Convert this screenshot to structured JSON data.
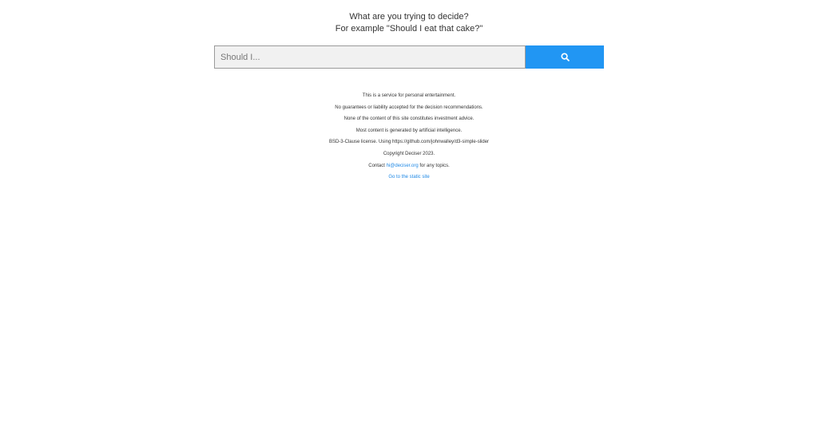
{
  "prompt": {
    "line1": "What are you trying to decide?",
    "line2": "For example \"Should I eat that cake?\""
  },
  "search": {
    "placeholder": "Should I...",
    "button_icon": "search-icon"
  },
  "footer": {
    "line1": "This is a service for personal entertainment.",
    "line2": "No guarantees or liability accepted for the decision recommendations.",
    "line3": "None of the content of this site constitutes investment advice.",
    "line4": "Most content is generated by artificial intelligence.",
    "line5": "BSD-3-Clause license. Using https://github.com/johnwalley/d3-simple-slider",
    "line6": "Copyright Deciser 2023.",
    "contact_prefix": "Contact ",
    "contact_email": "hi@deciser.org",
    "contact_suffix": " for any topics.",
    "static_link": "Go to the static site"
  },
  "colors": {
    "accent": "#2196f3",
    "link": "#1e88e5",
    "input_bg": "#f1f1f1"
  }
}
